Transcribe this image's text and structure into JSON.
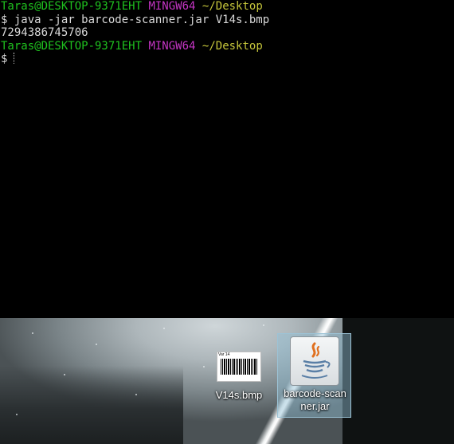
{
  "terminal": {
    "prompt1": {
      "user_host": "Taras@DESKTOP-9371EHT",
      "env": "MINGW64",
      "path": "~/Desktop"
    },
    "command": "$ java -jar barcode-scanner.jar V14s.bmp",
    "output": "7294386745706",
    "prompt2": {
      "user_host": "Taras@DESKTOP-9371EHT",
      "env": "MINGW64",
      "path": "~/Desktop"
    },
    "current_prompt": "$"
  },
  "desktop": {
    "icons": [
      {
        "label": "V14s.bmp",
        "icon": "bitmap-image-icon",
        "thumbnail_text": "Var 14"
      },
      {
        "label_line1": "barcode-scan",
        "label_line2": "ner.jar",
        "icon": "java-jar-icon",
        "selected": true
      }
    ]
  },
  "colors": {
    "prompt_user": "#1fc21f",
    "prompt_env": "#c435c4",
    "prompt_path": "#c6c63b",
    "terminal_bg": "#000000",
    "selection": "#9cc3d6"
  }
}
